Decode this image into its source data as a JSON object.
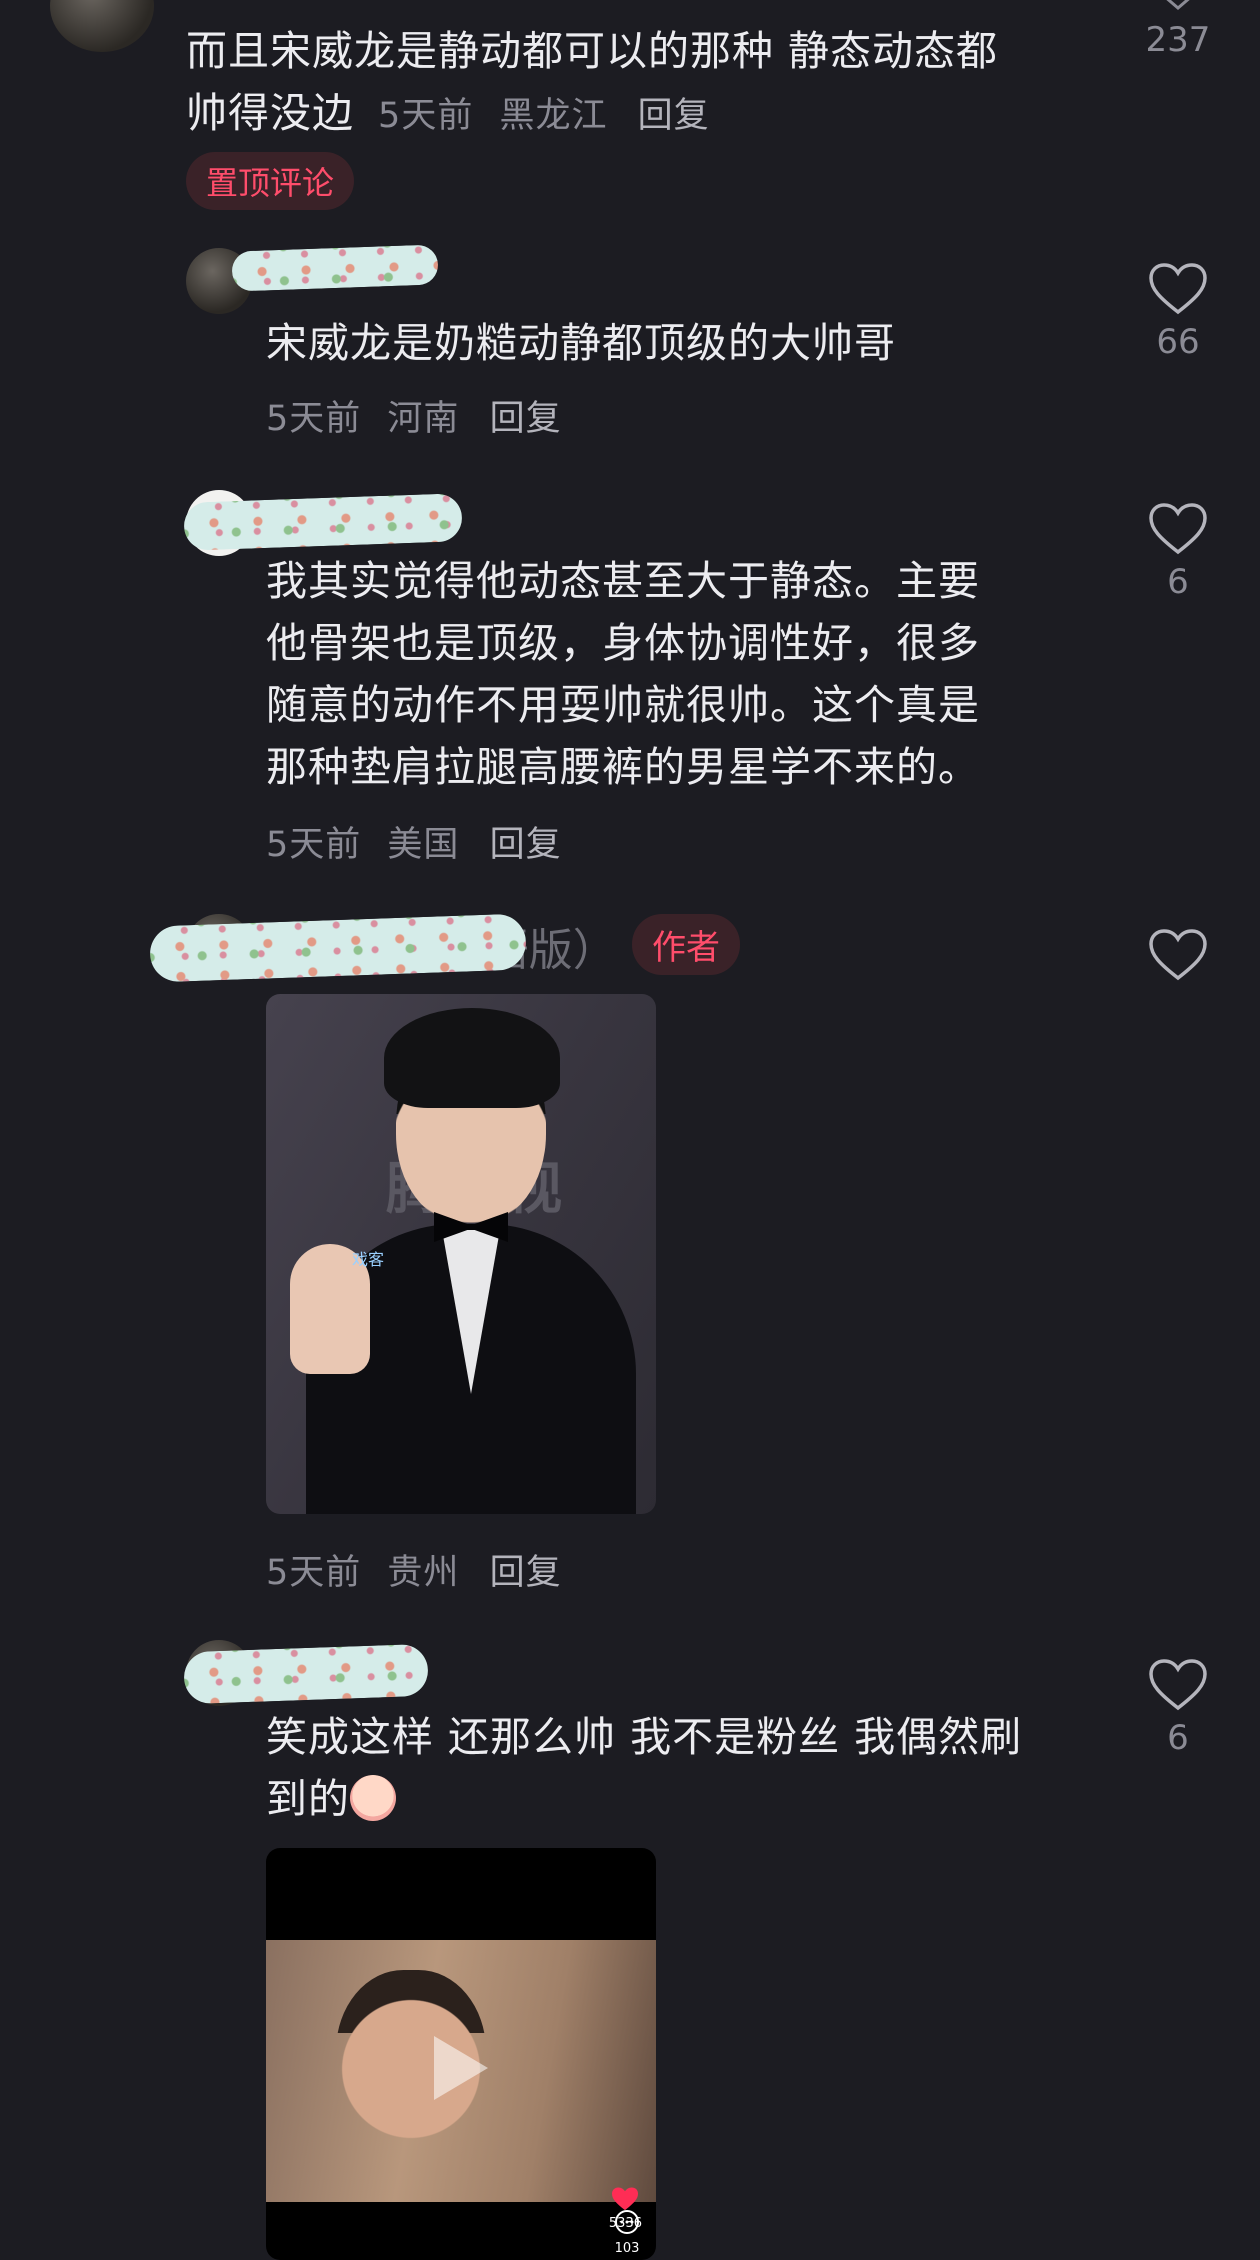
{
  "comments": [
    {
      "text_line1": "而且宋威龙是静动都可以的那种 静态动态都",
      "text_line2": "帅得没边",
      "time": "5天前",
      "location": "黑龙江",
      "reply": "回复",
      "pinned_label": "置顶评论",
      "like_count": "237"
    },
    {
      "text": "宋威龙是奶糙动静都顶级的大帅哥",
      "time": "5天前",
      "location": "河南",
      "reply": "回复",
      "like_count": "66"
    },
    {
      "lines": [
        "我其实觉得他动态甚至大于静态。主要",
        "他骨架也是顶级，身体协调性好，很多",
        "随意的动作不用耍帅就很帅。这个真是",
        "那种垫肩拉腿高腰裤的男星学不来的。"
      ],
      "time": "5天前",
      "location": "美国",
      "reply": "回复",
      "like_count": "6"
    },
    {
      "name_visible": "omo（无语版）",
      "author_label": "作者",
      "photo_text": "腾讯视",
      "photo_logo": "戏客",
      "time": "5天前",
      "location": "贵州",
      "reply": "回复"
    },
    {
      "text_line1": "笑成这样 还那么帅 我不是粉丝 我偶然刷",
      "text_line2": "到的",
      "like_count": "6",
      "video_likes": "5336",
      "video_comments": "103"
    }
  ],
  "icons": {
    "like": "heart-outline-icon",
    "play": "play-icon",
    "video_like": "heart-filled-icon",
    "video_comment": "comment-icon"
  },
  "colors": {
    "background": "#1c1c22",
    "accent": "#ff4d6b",
    "muted": "#8b8b95"
  }
}
